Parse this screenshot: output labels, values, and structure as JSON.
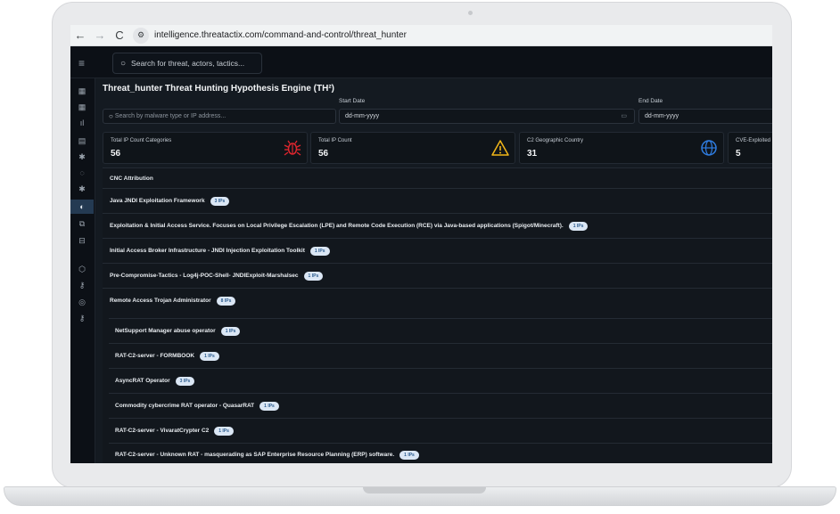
{
  "browser": {
    "back": "←",
    "forward": "→",
    "reload": "C",
    "site_info": "⚙",
    "url": "intelligence.threatactix.com/command-and-control/threat_hunter"
  },
  "header": {
    "menu_icon": "≡",
    "search_placeholder": "Search for threat, actors, tactics..."
  },
  "sidebar": {
    "items": [
      {
        "icon": "grid-icon",
        "glyph": "▦"
      },
      {
        "icon": "grid-icon",
        "glyph": "▦"
      },
      {
        "icon": "bar-chart-icon",
        "glyph": "ıl"
      },
      {
        "icon": "document-icon",
        "glyph": "▤"
      },
      {
        "icon": "bug-icon",
        "glyph": "✱"
      },
      {
        "icon": "shield-icon",
        "glyph": "◌"
      },
      {
        "icon": "bug-icon",
        "glyph": "✱"
      },
      {
        "icon": "hunt-icon",
        "glyph": "◐"
      },
      {
        "icon": "network-icon",
        "glyph": "⧉"
      },
      {
        "icon": "database-icon",
        "glyph": "⊟"
      },
      {
        "icon": "cube-icon",
        "glyph": "⬡"
      },
      {
        "icon": "key-icon",
        "glyph": "⚷"
      },
      {
        "icon": "coin-icon",
        "glyph": "◎"
      },
      {
        "icon": "key-icon",
        "glyph": "⚷"
      }
    ]
  },
  "page": {
    "title": "Threat_hunter Threat Hunting Hypothesis Engine (TH²)",
    "search_placeholder": "Search by malware type or IP address...",
    "start_date_label": "Start Date",
    "start_date_value": "dd-mm-yyyy",
    "end_date_label": "End Date",
    "end_date_value": "dd-mm-yyyy"
  },
  "stats": [
    {
      "label": "Total IP Count Categories",
      "value": "56",
      "icon": "bug-icon",
      "color": "#e0262e"
    },
    {
      "label": "Total IP Count",
      "value": "56",
      "icon": "warning-icon",
      "color": "#f2b619"
    },
    {
      "label": "C2 Geographic Country",
      "value": "31",
      "icon": "globe-icon",
      "color": "#2f7de1"
    },
    {
      "label": "CVE-Exploited",
      "value": "5",
      "icon": "",
      "color": ""
    }
  ],
  "cnc": {
    "title": "CNC Attribution",
    "rows": [
      {
        "label": "Java JNDI Exploitation Framework",
        "badge": "3 IPs"
      },
      {
        "label": "Exploitation & Initial Access Service. Focuses on Local Privilege Escalation (LPE) and Remote Code Execution (RCE) via Java-based applications (Spigot/Minecraft).",
        "badge": "1 IPs"
      },
      {
        "label": "Initial Access Broker Infrastructure - JNDI Injection Exploitation Toolkit",
        "badge": "1 IPs"
      },
      {
        "label": "Pre-Compromise-Tactics - Log4j-POC-Shell- JNDIExploit-Marshalsec",
        "badge": "1 IPs"
      },
      {
        "label": "Remote Access Trojan Administrator",
        "badge": "8 IPs"
      }
    ],
    "sub_rows": [
      {
        "label": "NetSupport Manager abuse operator",
        "badge": "1 IPs"
      },
      {
        "label": "RAT-C2-server - FORMBOOK",
        "badge": "1 IPs"
      },
      {
        "label": "AsyncRAT Operator",
        "badge": "3 IPs"
      },
      {
        "label": "Commodity cybercrime RAT operator - QuasarRAT",
        "badge": "1 IPs"
      },
      {
        "label": "RAT-C2-server - VivaratCrypter C2",
        "badge": "1 IPs"
      },
      {
        "label": "RAT-C2-server - Unknown RAT - masquerading as SAP Enterprise Resource Planning (ERP) software.",
        "badge": "1 IPs"
      }
    ]
  }
}
